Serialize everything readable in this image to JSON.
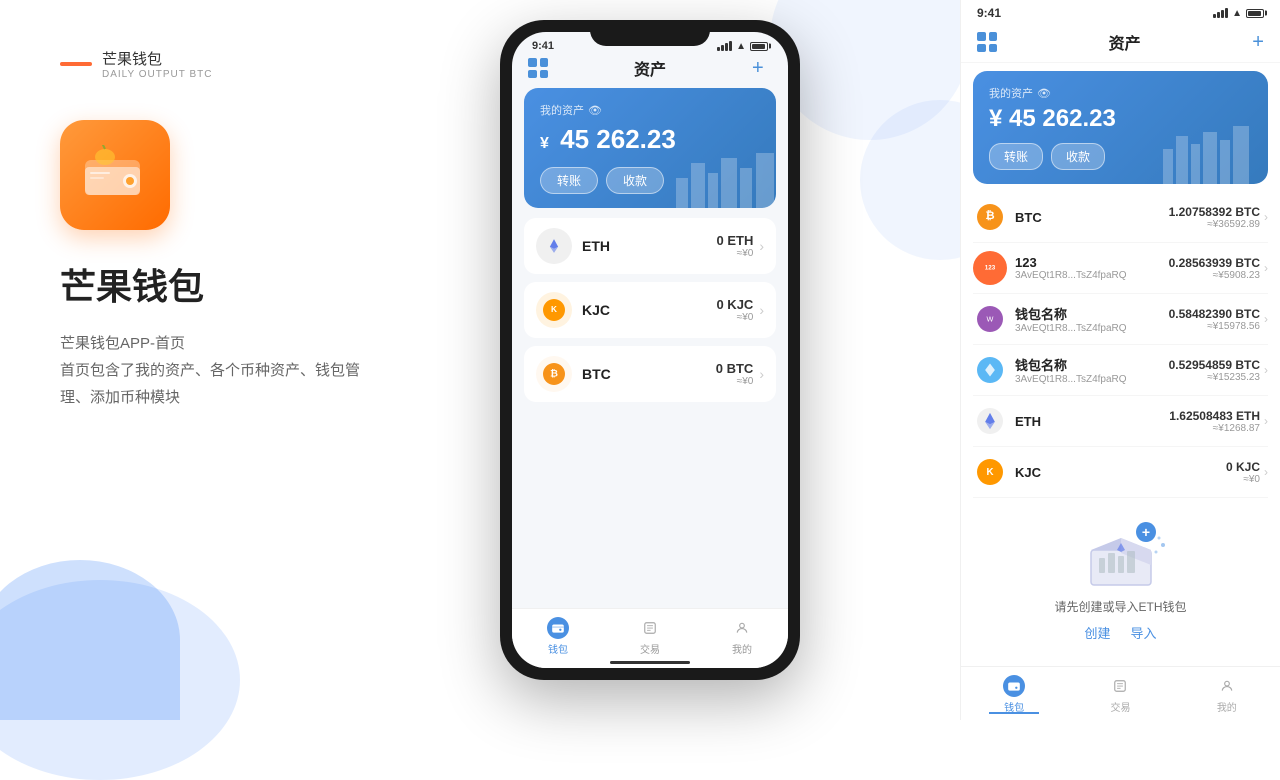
{
  "left": {
    "brand_line_color": "#ff6b35",
    "brand_name": "芒果钱包",
    "brand_sub": "DAILY OUTPUT BTC",
    "app_title": "芒果钱包",
    "app_desc_line1": "芒果钱包APP-首页",
    "app_desc_line2": "首页包含了我的资产、各个币种资产、钱包管",
    "app_desc_line3": "理、添加币种模块"
  },
  "phone": {
    "status_time": "9:41",
    "header_title": "资产",
    "asset_label": "我的资产",
    "asset_amount": "45 262.23",
    "asset_currency": "¥",
    "btn_transfer": "转账",
    "btn_receive": "收款",
    "coins": [
      {
        "symbol": "ETH",
        "name": "ETH",
        "amount": "0 ETH",
        "approx": "≈¥0",
        "type": "eth"
      },
      {
        "symbol": "KJC",
        "name": "KJC",
        "amount": "0 KJC",
        "approx": "≈¥0",
        "type": "kjc"
      },
      {
        "symbol": "BTC",
        "name": "BTC",
        "amount": "0 BTC",
        "approx": "≈¥0",
        "type": "btc"
      }
    ],
    "nav": [
      {
        "label": "钱包",
        "active": true
      },
      {
        "label": "交易",
        "active": false
      },
      {
        "label": "我的",
        "active": false
      }
    ]
  },
  "right": {
    "status_time": "9:41",
    "header_title": "资产",
    "asset_label": "我的资产",
    "asset_amount": "45 262.23",
    "asset_currency": "¥",
    "btn_transfer": "转账",
    "btn_receive": "收款",
    "coins": [
      {
        "name": "BTC",
        "addr": "",
        "amount": "1.20758392 BTC",
        "cny": "≈¥36592.89",
        "type": "btc",
        "has_addr": false
      },
      {
        "name": "123",
        "addr": "3AvEQt1R8...TsZ4fpaRQ",
        "amount": "0.28563939 BTC",
        "cny": "≈¥5908.23",
        "type": "custom1",
        "has_addr": true
      },
      {
        "name": "钱包名称",
        "addr": "3AvEQt1R8...TsZ4fpaRQ",
        "amount": "0.58482390 BTC",
        "cny": "≈¥15978.56",
        "type": "custom2",
        "has_addr": true
      },
      {
        "name": "钱包名称",
        "addr": "3AvEQt1R8...TsZ4fpaRQ",
        "amount": "0.52954859 BTC",
        "cny": "≈¥15235.23",
        "type": "custom3",
        "has_addr": true
      },
      {
        "name": "ETH",
        "addr": "",
        "amount": "1.62508483 ETH",
        "cny": "≈¥1268.87",
        "type": "eth",
        "has_addr": false
      },
      {
        "name": "KJC",
        "addr": "",
        "amount": "0 KJC",
        "cny": "≈¥0",
        "type": "kjc",
        "has_addr": false
      }
    ],
    "eth_prompt": "请先创建或导入ETH钱包",
    "eth_btn_create": "创建",
    "eth_btn_import": "导入",
    "nav": [
      {
        "label": "钱包",
        "active": true
      },
      {
        "label": "交易",
        "active": false
      },
      {
        "label": "我的",
        "active": false
      }
    ]
  }
}
